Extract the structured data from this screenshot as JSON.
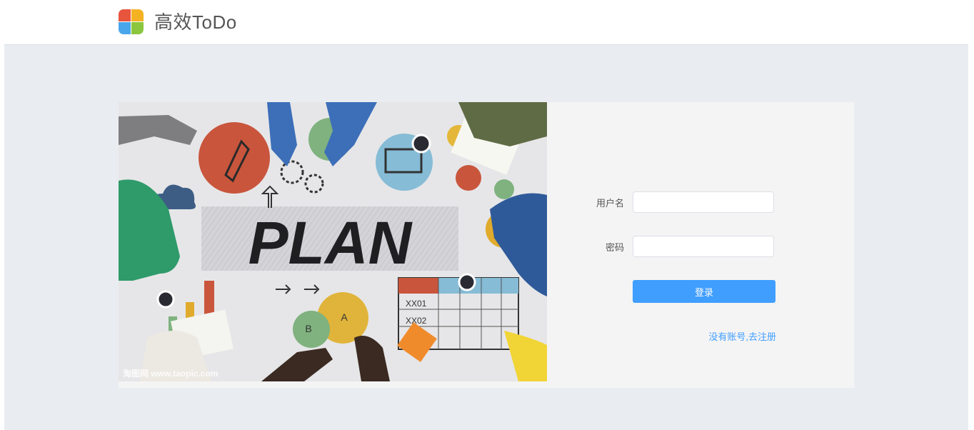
{
  "header": {
    "app_title": "高效ToDo",
    "logo_icon": "windows-logo-icon"
  },
  "login": {
    "username_label": "用户名",
    "username_value": "",
    "password_label": "密码",
    "password_value": "",
    "submit_label": "登录",
    "register_link": "没有账号,去注册"
  },
  "hero": {
    "board_text": "PLAN",
    "bubble_a": "A",
    "bubble_b": "B",
    "table_row_1": "XX01",
    "table_row_2": "XX02",
    "watermark": "淘图网 www.taopic.com"
  },
  "colors": {
    "accent": "#409eff",
    "stage_bg": "#e9edf1",
    "card_bg": "#f4f4f4"
  }
}
